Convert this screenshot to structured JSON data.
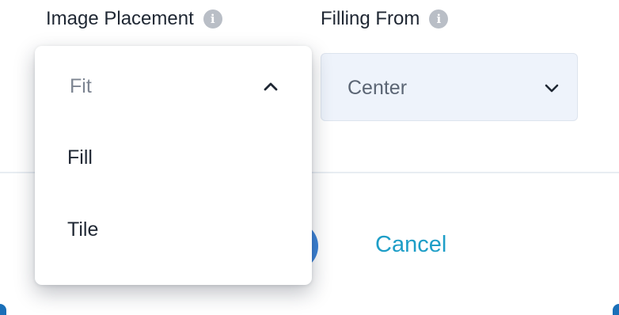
{
  "image_placement": {
    "label": "Image Placement",
    "info_icon_glyph": "i",
    "selected_value": "Fit",
    "options": [
      "Fill",
      "Tile"
    ]
  },
  "filling_from": {
    "label": "Filling From",
    "info_icon_glyph": "i",
    "value": "Center"
  },
  "footer": {
    "cancel_label": "Cancel"
  },
  "colors": {
    "accent_link": "#1e9ec7",
    "primary_button": "#3b82d6",
    "select_background": "#eef3fb",
    "info_icon": "#b9bec6"
  },
  "icons": {
    "placement_info": "info-icon",
    "filling_info": "info-icon",
    "dropdown_open": "chevron-up-icon",
    "filling_select": "chevron-down-icon"
  }
}
